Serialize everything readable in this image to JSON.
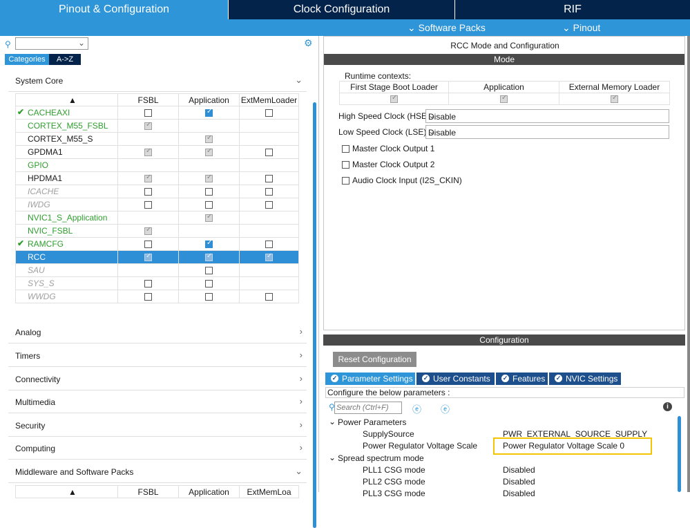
{
  "top_tabs": [
    {
      "label": "Pinout & Configuration"
    },
    {
      "label": "Clock Configuration"
    },
    {
      "label": "RIF"
    }
  ],
  "sub_links": [
    {
      "label": "Software Packs",
      "icon": "chevron-down-icon"
    },
    {
      "label": "Pinout",
      "icon": "chevron-down-icon"
    }
  ],
  "left": {
    "search_value": "",
    "view_buttons": [
      "Categories",
      "A->Z"
    ],
    "system_core_label": "System Core",
    "table_headers": [
      "FSBL",
      "Application",
      "ExtMemLoader"
    ],
    "components": [
      {
        "name": "CACHEAXI",
        "style": "green",
        "tick": true,
        "fsbl": "empty",
        "app": "blue",
        "ext": "empty"
      },
      {
        "name": "CORTEX_M55_FSBL",
        "style": "green",
        "tick": false,
        "fsbl": "gray",
        "app": "",
        "ext": ""
      },
      {
        "name": "CORTEX_M55_S",
        "style": "normal",
        "tick": false,
        "fsbl": "",
        "app": "gray",
        "ext": ""
      },
      {
        "name": "GPDMA1",
        "style": "normal",
        "tick": false,
        "fsbl": "gray",
        "app": "gray",
        "ext": "empty"
      },
      {
        "name": "GPIO",
        "style": "green",
        "tick": false,
        "fsbl": "",
        "app": "",
        "ext": ""
      },
      {
        "name": "HPDMA1",
        "style": "normal",
        "tick": false,
        "fsbl": "gray",
        "app": "gray",
        "ext": "empty"
      },
      {
        "name": "ICACHE",
        "style": "disabled",
        "tick": false,
        "fsbl": "empty",
        "app": "empty",
        "ext": "empty"
      },
      {
        "name": "IWDG",
        "style": "disabled",
        "tick": false,
        "fsbl": "empty",
        "app": "empty",
        "ext": "empty"
      },
      {
        "name": "NVIC1_S_Application",
        "style": "green",
        "tick": false,
        "fsbl": "",
        "app": "gray",
        "ext": ""
      },
      {
        "name": "NVIC_FSBL",
        "style": "green",
        "tick": false,
        "fsbl": "gray",
        "app": "",
        "ext": ""
      },
      {
        "name": "RAMCFG",
        "style": "green",
        "tick": true,
        "fsbl": "empty",
        "app": "blue",
        "ext": "empty"
      },
      {
        "name": "RCC",
        "style": "selected",
        "tick": false,
        "fsbl": "gray",
        "app": "gray",
        "ext": "gray"
      },
      {
        "name": "SAU",
        "style": "disabled",
        "tick": false,
        "fsbl": "",
        "app": "empty",
        "ext": ""
      },
      {
        "name": "SYS_S",
        "style": "disabled",
        "tick": false,
        "fsbl": "empty",
        "app": "empty",
        "ext": ""
      },
      {
        "name": "WWDG",
        "style": "disabled",
        "tick": false,
        "fsbl": "empty",
        "app": "empty",
        "ext": "empty"
      }
    ],
    "sections": [
      "Analog",
      "Timers",
      "Connectivity",
      "Multimedia",
      "Security",
      "Computing",
      "Middleware and Software Packs"
    ],
    "bottom_headers": [
      "FSBL",
      "Application",
      "ExtMemLoa"
    ]
  },
  "right": {
    "title": "RCC Mode and Configuration",
    "mode_label": "Mode",
    "runtime_label": "Runtime contexts:",
    "contexts": [
      "First Stage Boot Loader",
      "Application",
      "External Memory Loader"
    ],
    "hse": {
      "label": "High Speed Clock (HSE)",
      "value": "Disable"
    },
    "lse": {
      "label": "Low Speed Clock (LSE)",
      "value": "Disable"
    },
    "checks": [
      "Master Clock Output 1",
      "Master Clock Output 2",
      "Audio Clock Input (I2S_CKIN)"
    ],
    "config_label": "Configuration",
    "reset_label": "Reset Configuration",
    "tabs": [
      "Parameter Settings",
      "User Constants",
      "Features",
      "NVIC Settings"
    ],
    "configure_text": "Configure the below parameters :",
    "search_placeholder": "Search (Ctrl+F)",
    "groups": {
      "power": "Power Parameters",
      "spread": "Spread spectrum mode"
    },
    "params": [
      {
        "name": "SupplySource",
        "value": "PWR_EXTERNAL_SOURCE_SUPPLY"
      },
      {
        "name": "Power Regulator Voltage Scale",
        "value": "Power Regulator Voltage Scale 0"
      },
      {
        "name": "PLL1 CSG mode",
        "value": "Disabled"
      },
      {
        "name": "PLL2 CSG mode",
        "value": "Disabled"
      },
      {
        "name": "PLL3 CSG mode",
        "value": "Disabled"
      }
    ]
  },
  "colors": {
    "tab_active": "#2d95d8",
    "tab_inactive": "#03234b",
    "selected_row": "#2f8fd6",
    "highlight": "#f5c400"
  }
}
